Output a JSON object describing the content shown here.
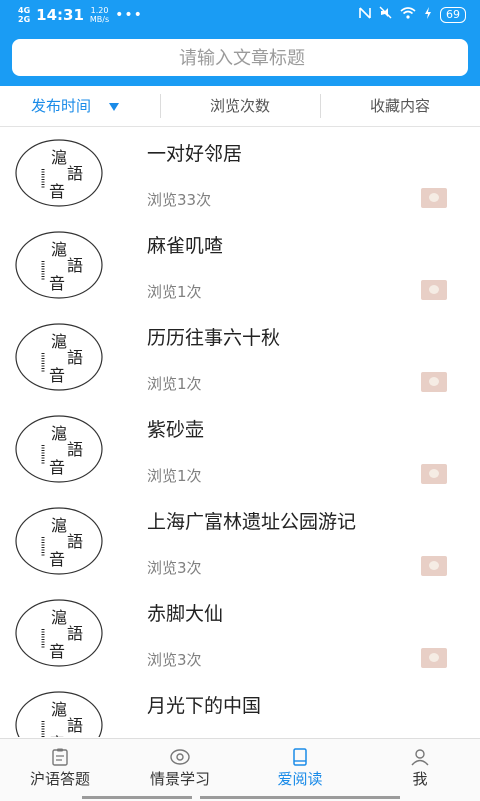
{
  "status_bar": {
    "network": "4G",
    "network2": "2G",
    "time": "14:31",
    "speed_value": "1.20",
    "speed_unit": "MB/s",
    "dots": "•••",
    "battery": "69"
  },
  "search": {
    "placeholder": "请输入文章标题"
  },
  "filters": [
    "发布时间",
    "浏览次数",
    "收藏内容"
  ],
  "articles": [
    {
      "title": "一对好邻居",
      "views": "浏览33次"
    },
    {
      "title": "麻雀叽喳",
      "views": "浏览1次"
    },
    {
      "title": "历历往事六十秋",
      "views": "浏览1次"
    },
    {
      "title": "紫砂壶",
      "views": "浏览1次"
    },
    {
      "title": "上海广富林遗址公园游记",
      "views": "浏览3次"
    },
    {
      "title": "赤脚大仙",
      "views": "浏览3次"
    },
    {
      "title": "月光下的中国",
      "views": ""
    }
  ],
  "bottom_nav": [
    "沪语答题",
    "情景学习",
    "爱阅读",
    "我"
  ],
  "colors": {
    "accent": "#1a9cf4",
    "active": "#1a8be8"
  }
}
